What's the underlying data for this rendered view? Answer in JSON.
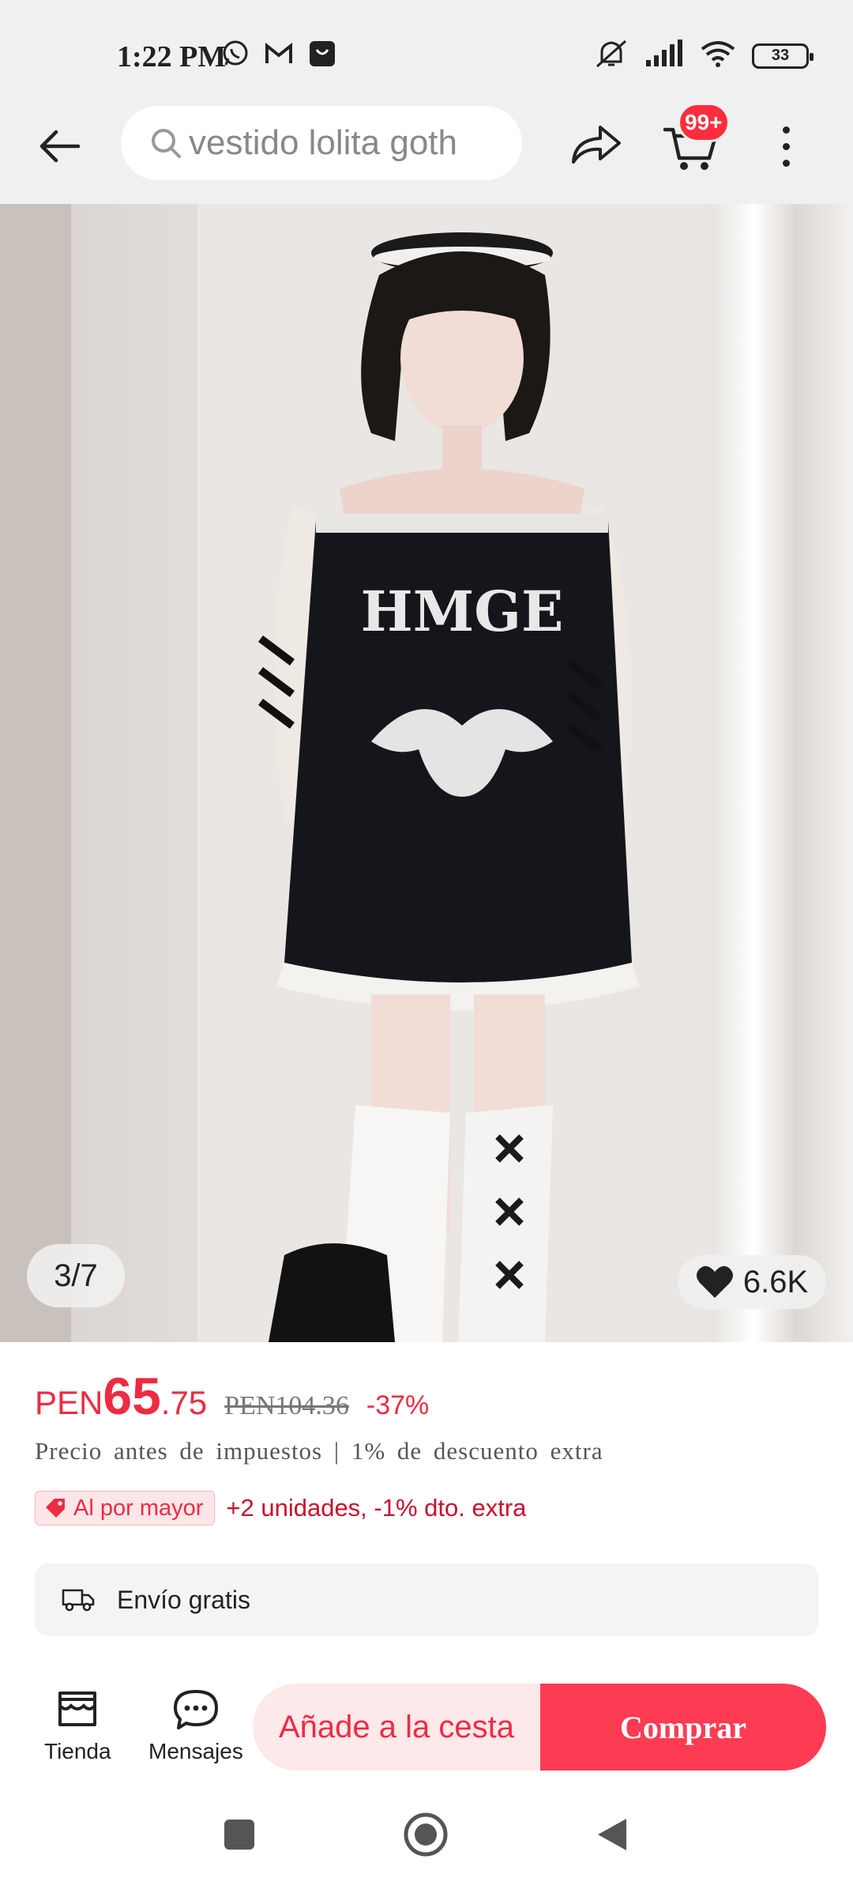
{
  "status_bar": {
    "time": "1:22 PM",
    "battery": "33"
  },
  "header": {
    "search_text": "vestido lolita goth",
    "cart_badge": "99+"
  },
  "gallery": {
    "counter": "3/7",
    "favorites": "6.6K"
  },
  "price": {
    "currency": "PEN",
    "integer": "65",
    "decimal": ".75",
    "original": "PEN104.36",
    "discount": "-37%",
    "tax_note": "Precio antes de impuestos | 1% de descuento extra"
  },
  "wholesale": {
    "tag": "Al por mayor",
    "text": "+2 unidades, -1% dto. extra"
  },
  "shipping": {
    "label": "Envío gratis"
  },
  "actions": {
    "store_label": "Tienda",
    "messages_label": "Mensajes",
    "add_to_cart": "Añade a la cesta",
    "buy": "Comprar"
  },
  "colors": {
    "accent": "#ee2b43",
    "buy_button": "#fd3b53",
    "cart_button_bg": "#fde8ea",
    "badge": "#ff2d3c"
  }
}
